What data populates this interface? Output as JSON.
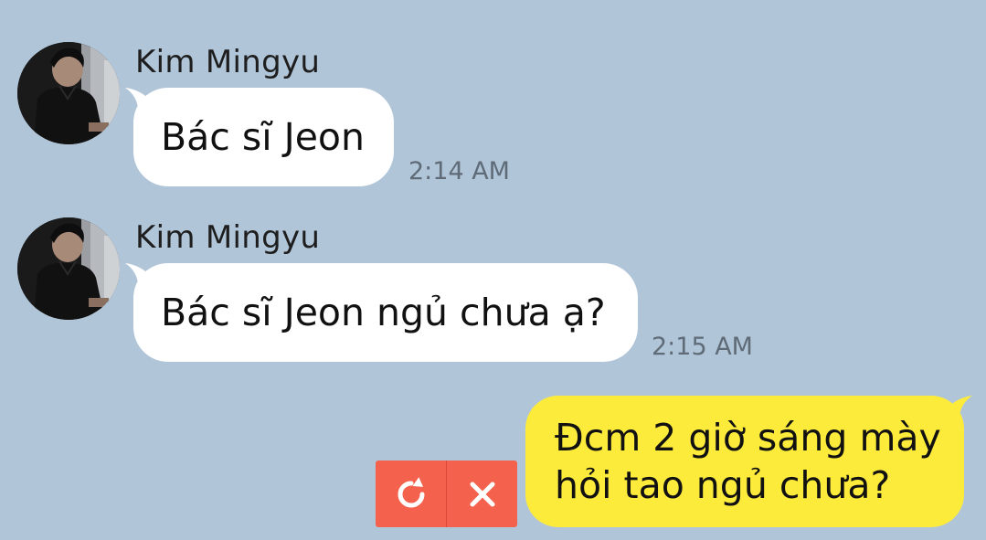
{
  "messages": [
    {
      "sender": "Kim Mingyu",
      "text": "Bác sĩ Jeon",
      "time": "2:14 AM",
      "avatar_icon": "profile-photo"
    },
    {
      "sender": "Kim Mingyu",
      "text": "Bác sĩ Jeon ngủ chưa ạ?",
      "time": "2:15 AM",
      "avatar_icon": "profile-photo"
    }
  ],
  "outgoing": {
    "line1": "Đcm 2 giờ sáng mày",
    "line2": "hỏi tao ngủ chưa?"
  },
  "failed_actions": {
    "retry_icon": "retry-icon",
    "delete_icon": "close-icon"
  },
  "colors": {
    "background": "#b1c5d9",
    "incoming_bubble": "#ffffff",
    "outgoing_bubble": "#fdeb3b",
    "failed_action": "#f4624d"
  }
}
